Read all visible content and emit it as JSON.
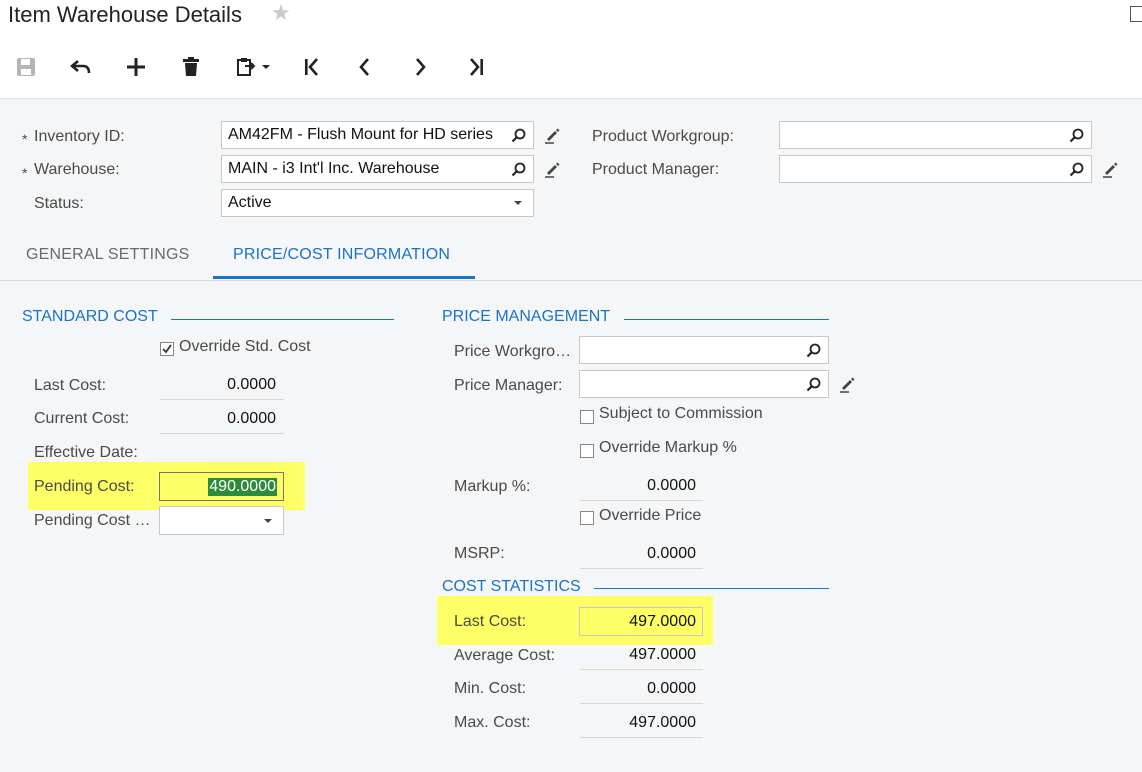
{
  "header": {
    "title": "Item Warehouse Details",
    "star_icon": "star-icon"
  },
  "toolbar": {
    "buttons": [
      "save-icon",
      "undo-icon",
      "add-icon",
      "delete-icon",
      "copy-paste-icon",
      "first-icon",
      "previous-icon",
      "next-icon",
      "last-icon"
    ]
  },
  "form": {
    "inventory_id_label": "Inventory ID:",
    "inventory_id_value": "AM42FM - Flush Mount for HD series",
    "warehouse_label": "Warehouse:",
    "warehouse_value": "MAIN - i3 Int'l Inc. Warehouse",
    "status_label": "Status:",
    "status_value": "Active",
    "product_workgroup_label": "Product Workgroup:",
    "product_workgroup_value": "",
    "product_manager_label": "Product Manager:",
    "product_manager_value": "",
    "required_marker": "*"
  },
  "tabs": {
    "general": "GENERAL SETTINGS",
    "price_cost": "PRICE/COST INFORMATION"
  },
  "standard_cost": {
    "title": "STANDARD COST",
    "override_label": "Override Std. Cost",
    "override_checked": true,
    "last_cost_label": "Last Cost:",
    "last_cost_value": "0.0000",
    "current_cost_label": "Current Cost:",
    "current_cost_value": "0.0000",
    "effective_date_label": "Effective Date:",
    "pending_cost_label": "Pending Cost:",
    "pending_cost_value": "490.0000",
    "pending_cost_date_label": "Pending Cost …",
    "pending_cost_date_value": ""
  },
  "price_management": {
    "title": "PRICE MANAGEMENT",
    "price_workgroup_label": "Price Workgro…",
    "price_workgroup_value": "",
    "price_manager_label": "Price Manager:",
    "price_manager_value": "",
    "subject_commission_label": "Subject to Commission",
    "override_markup_label": "Override Markup %",
    "markup_label": "Markup %:",
    "markup_value": "0.0000",
    "override_price_label": "Override Price",
    "msrp_label": "MSRP:",
    "msrp_value": "0.0000"
  },
  "cost_statistics": {
    "title": "COST STATISTICS",
    "last_cost_label": "Last Cost:",
    "last_cost_value": "497.0000",
    "average_cost_label": "Average Cost:",
    "average_cost_value": "497.0000",
    "min_cost_label": "Min. Cost:",
    "min_cost_value": "0.0000",
    "max_cost_label": "Max. Cost:",
    "max_cost_value": "497.0000"
  },
  "colors": {
    "accent": "#1a73c7",
    "highlight": "#ffff66"
  }
}
